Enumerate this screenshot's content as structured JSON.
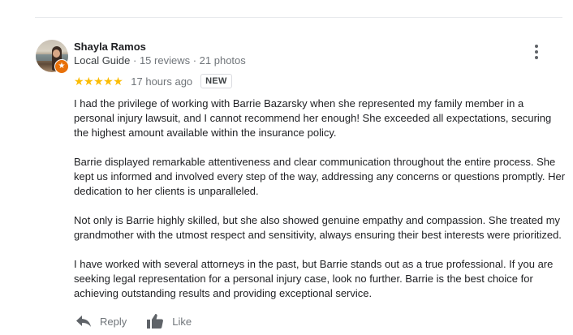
{
  "review": {
    "reviewer_name": "Shayla Ramos",
    "guide_label": "Local Guide",
    "meta_separator_1": " · ",
    "reviews_count": "15 reviews",
    "meta_separator_2": " · ",
    "photos_count": "21 photos",
    "stars": "★★★★★",
    "rating": 5,
    "time": "17 hours ago",
    "new_badge": "NEW",
    "paragraphs": [
      "I had the privilege of working with Barrie Bazarsky when she represented my family member in a personal injury lawsuit, and I cannot recommend her enough! She exceeded all expectations, securing the highest amount available within the insurance policy.",
      "Barrie displayed remarkable attentiveness and clear communication throughout the entire process. She kept us informed and involved every step of the way, addressing any concerns or questions promptly. Her dedication to her clients is unparalleled.",
      "Not only is Barrie highly skilled, but she also showed genuine empathy and compassion. She treated my grandmother with the utmost respect and sensitivity, always ensuring their best interests were prioritized.",
      "I have worked with several attorneys in the past, but Barrie stands out as a true professional. If you are seeking legal representation for a personal injury case, look no further. Barrie is the best choice for achieving outstanding results and providing exceptional service."
    ]
  },
  "actions": {
    "reply_label": "Reply",
    "like_label": "Like"
  },
  "colors": {
    "star": "#fbbc04",
    "guide_badge": "#e8710a",
    "muted_text": "#70757a"
  },
  "icons": {
    "more": "more-vert-icon",
    "reply": "reply-arrow-icon",
    "like": "thumbs-up-icon",
    "guide": "local-guide-star-icon"
  }
}
